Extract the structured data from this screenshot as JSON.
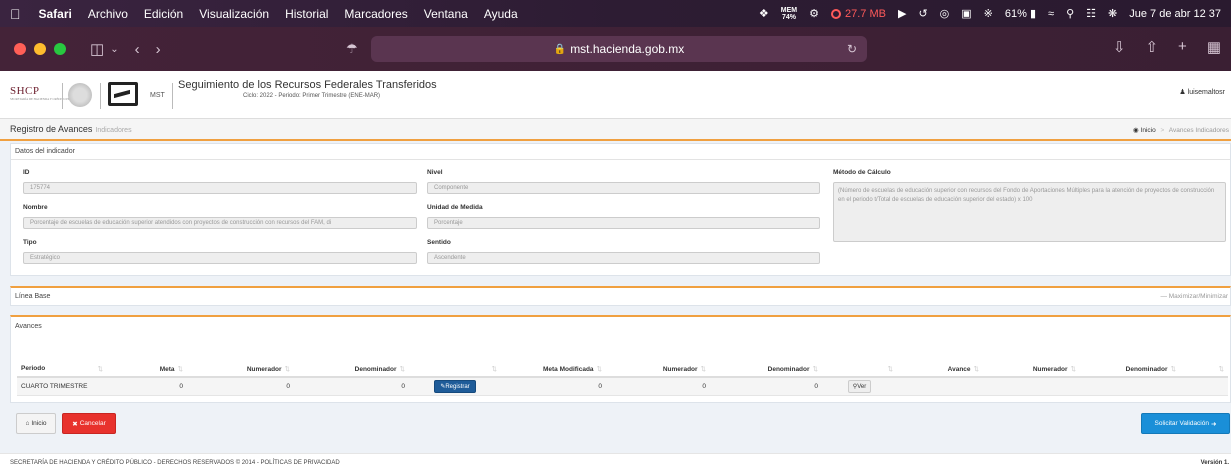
{
  "menubar": {
    "apple": "",
    "items": [
      "Safari",
      "Archivo",
      "Edición",
      "Visualización",
      "Historial",
      "Marcadores",
      "Ventana",
      "Ayuda"
    ],
    "mem_label": "MEM",
    "mem_value": "74%",
    "mem_usage": "27.7 MB",
    "battery": "61%",
    "datetime": "Jue 7 de abr  12 37"
  },
  "browser": {
    "url": "mst.hacienda.gob.mx"
  },
  "header": {
    "shcp": "SHCP",
    "shcp_sub": "SECRETARÍA DE HACIENDA Y CRÉDITO PÚBLICO",
    "mst": "MST",
    "title": "Seguimiento de los Recursos Federales Transferidos",
    "subtitle": "Ciclo: 2022 - Periodo: Primer Trimestre (ENE-MAR)",
    "user": "luisemaltosr"
  },
  "breadcrumb": {
    "title": "Registro de Avances",
    "title_small": "Indicadores",
    "home": "Inicio",
    "current": "Avances Indicadores"
  },
  "datos": {
    "panel_title": "Datos del indicador",
    "id_label": "ID",
    "id_value": "175774",
    "nivel_label": "Nivel",
    "nivel_value": "Componente",
    "metodo_label": "Método de Cálculo",
    "metodo_value": "(Número de escuelas de educación superior con recursos del Fondo de Aportaciones Múltiples para la atención de proyectos de construcción en el periodo t/Total de  escuelas de educación superior del estado) x 100",
    "nombre_label": "Nombre",
    "nombre_value": "Porcentaje de escuelas de educación superior atendidos con proyectos de construcción con recursos del FAM, di",
    "unidad_label": "Unidad de Medida",
    "unidad_value": "Porcentaje",
    "tipo_label": "Tipo",
    "tipo_value": "Estratégico",
    "sentido_label": "Sentido",
    "sentido_value": "Ascendente"
  },
  "linea_base": {
    "title": "Línea Base",
    "toggle": "Maximizar/Minimizar"
  },
  "avances": {
    "title": "Avances",
    "columns": [
      "Periodo",
      "Meta",
      "Numerador",
      "Denominador",
      "",
      "Meta Modificada",
      "Numerador",
      "Denominador",
      "",
      "Avance",
      "Numerador",
      "Denominador",
      ""
    ],
    "row": {
      "periodo": "CUARTO TRIMESTRE",
      "meta": "0",
      "numerador": "0",
      "denominador": "0",
      "registrar": "Registrar",
      "meta_mod": "0",
      "numerador2": "0",
      "denominador2": "0",
      "ver": "Ver"
    }
  },
  "actions": {
    "inicio": "Inicio",
    "cancelar": "Cancelar",
    "solicitar": "Solicitar Validación"
  },
  "footer": {
    "left": "SECRETARÍA DE HACIENDA Y CRÉDITO PÚBLICO - DERECHOS RESERVADOS © 2014 - POLÍTICAS DE PRIVACIDAD",
    "right": "Versión 1."
  }
}
